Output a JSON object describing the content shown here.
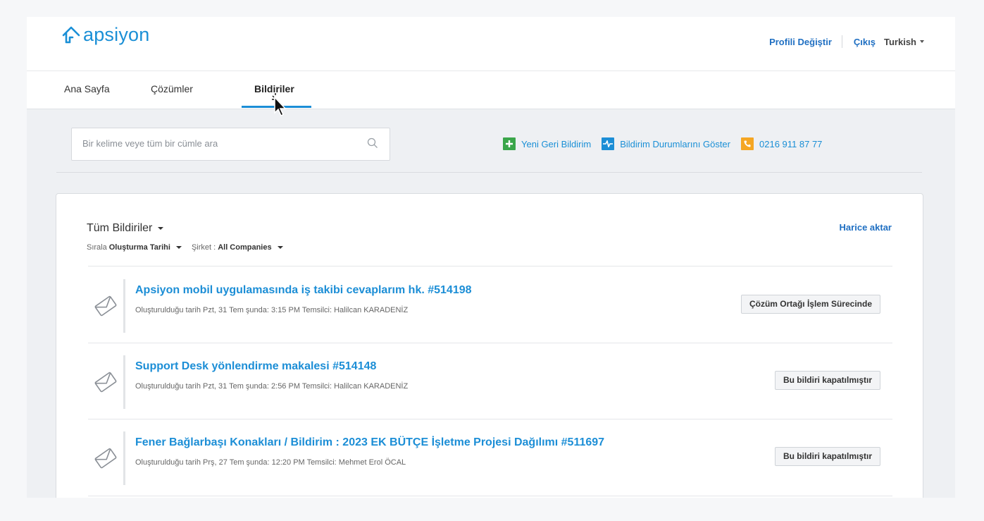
{
  "header": {
    "logo_text": "apsiyon",
    "change_profile": "Profili Değiştir",
    "logout": "Çıkış",
    "language": "Turkish"
  },
  "nav": {
    "tabs": [
      {
        "label": "Ana Sayfa",
        "active": false
      },
      {
        "label": "Çözümler",
        "active": false
      },
      {
        "label": "Bildiriler",
        "active": true
      }
    ]
  },
  "search": {
    "placeholder": "Bir kelime veye tüm bir cümle ara",
    "value": ""
  },
  "actions": {
    "new_feedback": "Yeni Geri Bildirim",
    "show_status": "Bildirim Durumlarını Göster",
    "phone": "0216 911 87 77"
  },
  "colors": {
    "accent": "#1c8ed6",
    "link": "#1f6fc2",
    "new_icon": "#3aa64a",
    "status_icon": "#1c8ed6",
    "phone_icon": "#f5a623"
  },
  "list": {
    "title": "Tüm Bildiriler",
    "sort_label": "Sırala",
    "sort_value": "Oluşturma Tarihi",
    "company_label": "Şirket :",
    "company_value": "All Companies",
    "export": "Harice aktar",
    "tickets": [
      {
        "title": "Apsiyon mobil uygulamasında iş takibi cevaplarım hk. #514198",
        "meta": "Oluşturulduğu tarih Pzt, 31 Tem şunda: 3:15 PM Temsilci: Halilcan KARADENİZ",
        "status": "Çözüm Ortağı İşlem Sürecinde",
        "icon": "envelope-icon"
      },
      {
        "title": "Support Desk yönlendirme makalesi #514148",
        "meta": "Oluşturulduğu tarih Pzt, 31 Tem şunda: 2:56 PM Temsilci: Halilcan KARADENİZ",
        "status": "Bu bildiri kapatılmıştır",
        "icon": "envelope-icon"
      },
      {
        "title": "Fener Bağlarbaşı Konakları / Bildirim : 2023 EK BÜTÇE İşletme Projesi Dağılımı #511697",
        "meta": "Oluşturulduğu tarih Prş, 27 Tem şunda: 12:20 PM Temsilci: Mehmet Erol ÖCAL",
        "status": "Bu bildiri kapatılmıştır",
        "icon": "envelope-icon"
      }
    ]
  }
}
